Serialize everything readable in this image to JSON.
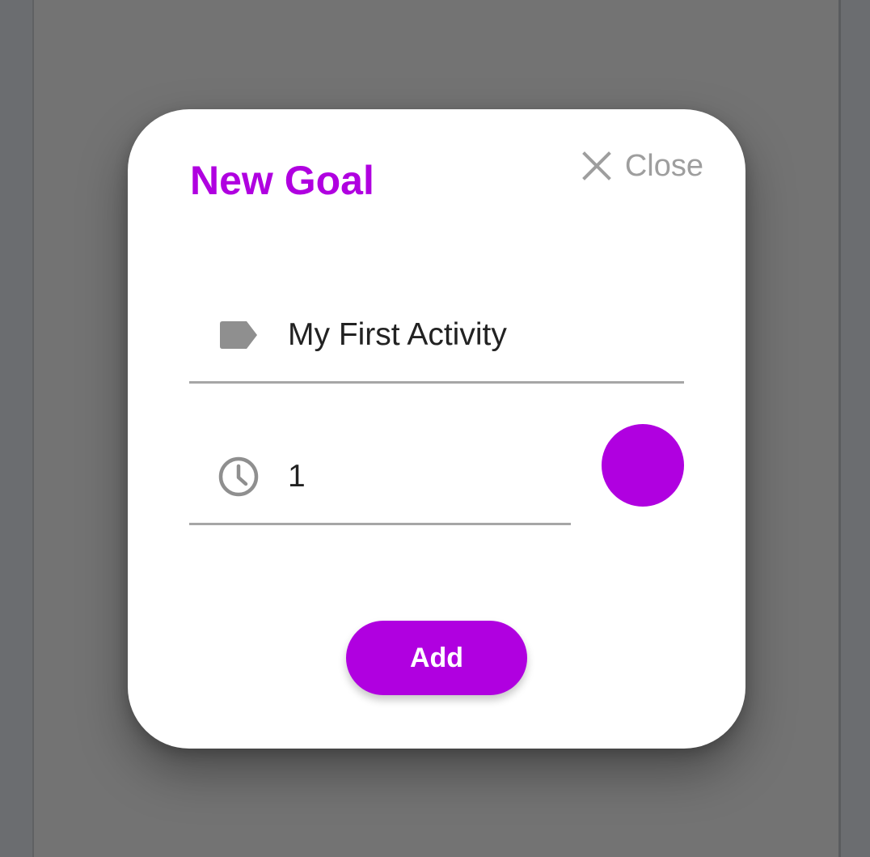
{
  "dialog": {
    "title": "New Goal",
    "close_label": "Close",
    "close_icon": "close-icon",
    "fields": {
      "name": {
        "icon": "label-tag-icon",
        "value": "My First Activity"
      },
      "duration": {
        "icon": "clock-icon",
        "value": "1"
      }
    },
    "color": "#b000e0",
    "add_label": "Add"
  },
  "theme": {
    "accent": "#b000e0",
    "backdrop": "#737373",
    "icon_gray": "#8f8f8f",
    "divider": "#a6a6a6"
  }
}
